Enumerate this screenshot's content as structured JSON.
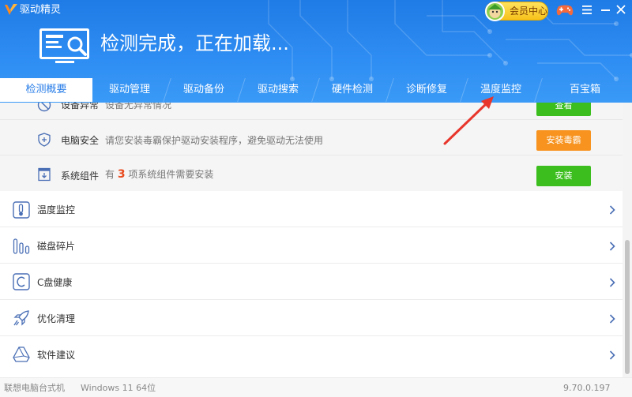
{
  "app": {
    "title": "驱动精灵",
    "status": "检测完成，正在加载...",
    "vip_label": "会员中心",
    "icons": {
      "logo": "app-logo-icon",
      "game": "gamepad-icon",
      "menu": "menu-icon",
      "minimize": "minimize-icon",
      "close": "close-icon"
    }
  },
  "tabs": [
    {
      "label": "检测概要",
      "active": true
    },
    {
      "label": "驱动管理",
      "active": false
    },
    {
      "label": "驱动备份",
      "active": false
    },
    {
      "label": "驱动搜索",
      "active": false
    },
    {
      "label": "硬件检测",
      "active": false
    },
    {
      "label": "诊断修复",
      "active": false
    },
    {
      "label": "温度监控",
      "active": false
    },
    {
      "label": "百宝箱",
      "active": false
    }
  ],
  "alerts": [
    {
      "name": "设备异常",
      "desc": "设备无异常情况",
      "button": "查看",
      "button_color": "#3cbf1e",
      "icon": "device-warning-icon"
    },
    {
      "name": "电脑安全",
      "desc": "请您安装毒霸保护驱动安装程序，避免驱动无法使用",
      "button": "安装毒霸",
      "button_color": "#f7931e",
      "icon": "shield-plus-icon"
    },
    {
      "name": "系统组件",
      "desc_prefix": "有",
      "desc_count": "3",
      "desc_suffix": "项系统组件需要安装",
      "button": "安装",
      "button_color": "#3cbf1e",
      "icon": "download-box-icon"
    }
  ],
  "tools": [
    {
      "label": "温度监控",
      "icon": "thermometer-icon"
    },
    {
      "label": "磁盘碎片",
      "icon": "disk-fragment-icon"
    },
    {
      "label": "C盘健康",
      "icon": "c-drive-icon"
    },
    {
      "label": "优化清理",
      "icon": "rocket-icon"
    },
    {
      "label": "软件建议",
      "icon": "triangle-drive-icon"
    }
  ],
  "footer": {
    "device": "联想电脑台式机",
    "os": "Windows 11 64位",
    "version": "9.70.0.197"
  },
  "colors": {
    "header_blue": "#2f8ef3",
    "accent_blue": "#2a7ee8",
    "green_button": "#3cbf1e",
    "orange_button": "#f7931e",
    "count_red": "#e84a1e",
    "annotation_red": "#e8362c"
  }
}
